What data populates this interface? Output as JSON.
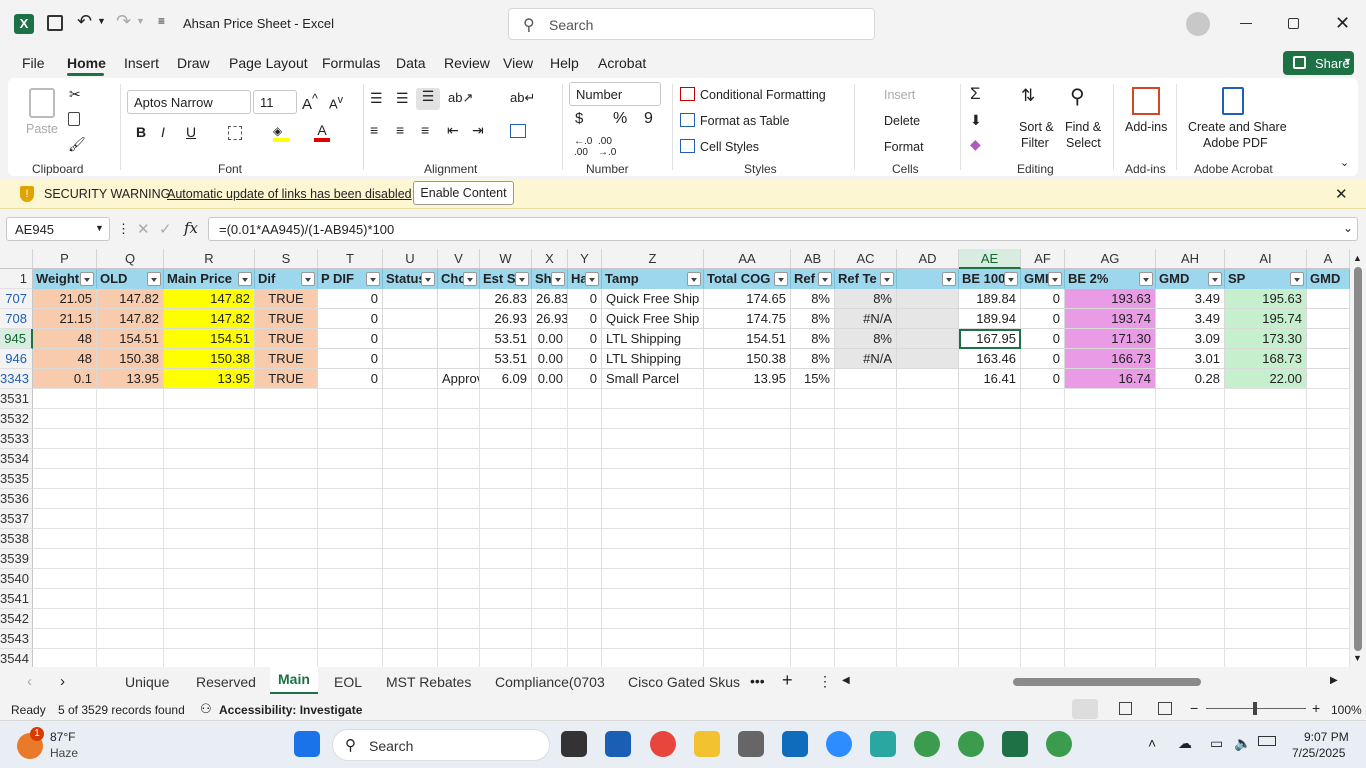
{
  "titlebar": {
    "title": "Ahsan Price Sheet  -  Excel",
    "search_placeholder": "Search"
  },
  "menu": [
    "File",
    "Home",
    "Insert",
    "Draw",
    "Page Layout",
    "Formulas",
    "Data",
    "Review",
    "View",
    "Help",
    "Acrobat"
  ],
  "share_label": "Share",
  "ribbon": {
    "paste": "Paste",
    "clipboard": "Clipboard",
    "font_name": "Aptos Narrow",
    "font_size": "11",
    "font": "Font",
    "alignment": "Alignment",
    "number_format": "Number",
    "number": "Number",
    "cond_format": "Conditional Formatting",
    "format_table": "Format as Table",
    "cell_styles": "Cell Styles",
    "styles": "Styles",
    "insert": "Insert",
    "delete": "Delete",
    "format": "Format",
    "cells": "Cells",
    "sort_filter": [
      "Sort &",
      "Filter"
    ],
    "find_select": [
      "Find &",
      "Select"
    ],
    "editing": "Editing",
    "addins_btn": "Add-ins",
    "addins": "Add-ins",
    "create_pdf": [
      "Create and Share",
      "Adobe PDF"
    ],
    "acrobat": "Adobe Acrobat"
  },
  "security": {
    "title": "SECURITY WARNING",
    "message": "Automatic update of links has been disabled",
    "button": "Enable Content"
  },
  "formula_bar": {
    "name_box": "AE945",
    "formula": "=(0.01*AA945)/(1-AB945)*100"
  },
  "columns": [
    "P",
    "Q",
    "R",
    "S",
    "T",
    "U",
    "V",
    "W",
    "X",
    "Y",
    "Z",
    "AA",
    "AB",
    "AC",
    "AD",
    "AE",
    "AF",
    "AG",
    "AH",
    "AI",
    "A"
  ],
  "headers": [
    "Weight",
    "OLD",
    "Main Price",
    "Dif",
    "P DIF",
    "Status",
    "Cho",
    "Est S",
    "Sh",
    "Ha",
    "Tamp",
    "Total COG",
    "Ref",
    "Ref Te",
    "",
    "BE 100",
    "GMI",
    "BE 2%",
    "GMD",
    "SP",
    "GMD"
  ],
  "header_row_num": "1",
  "rows": [
    {
      "num": "707",
      "cells": [
        "21.05",
        "147.82",
        "147.82",
        "TRUE",
        "0",
        "",
        "",
        "26.83",
        "26.83",
        "0",
        "Quick Free Ship",
        "174.65",
        "8%",
        "8%",
        "",
        "189.84",
        "0",
        "193.63",
        "3.49",
        "195.63",
        ""
      ]
    },
    {
      "num": "708",
      "cells": [
        "21.15",
        "147.82",
        "147.82",
        "TRUE",
        "0",
        "",
        "",
        "26.93",
        "26.93",
        "0",
        "Quick Free Ship",
        "174.75",
        "8%",
        "#N/A",
        "",
        "189.94",
        "0",
        "193.74",
        "3.49",
        "195.74",
        ""
      ]
    },
    {
      "num": "945",
      "cells": [
        "48",
        "154.51",
        "154.51",
        "TRUE",
        "0",
        "",
        "",
        "53.51",
        "0.00",
        "0",
        "LTL Shipping",
        "154.51",
        "8%",
        "8%",
        "",
        "167.95",
        "0",
        "171.30",
        "3.09",
        "173.30",
        ""
      ]
    },
    {
      "num": "946",
      "cells": [
        "48",
        "150.38",
        "150.38",
        "TRUE",
        "0",
        "",
        "",
        "53.51",
        "0.00",
        "0",
        "LTL Shipping",
        "150.38",
        "8%",
        "#N/A",
        "",
        "163.46",
        "0",
        "166.73",
        "3.01",
        "168.73",
        ""
      ]
    },
    {
      "num": "3343",
      "cells": [
        "0.1",
        "13.95",
        "13.95",
        "TRUE",
        "0",
        "",
        "Approv",
        "6.09",
        "0.00",
        "0",
        "Small Parcel",
        "13.95",
        "15%",
        "",
        "",
        "16.41",
        "0",
        "16.74",
        "0.28",
        "22.00",
        ""
      ]
    }
  ],
  "empty_rows": [
    "3531",
    "3532",
    "3533",
    "3534",
    "3535",
    "3536",
    "3537",
    "3538",
    "3539",
    "3540",
    "3541",
    "3542",
    "3543",
    "3544"
  ],
  "sheet_tabs": [
    "Unique",
    "Reserved",
    "Main",
    "EOL",
    "MST Rebates",
    "Compliance(0703",
    "Cisco Gated Skus"
  ],
  "active_tab": "Main",
  "status": {
    "ready": "Ready",
    "records": "5 of 3529 records found",
    "accessibility": "Accessibility: Investigate",
    "zoom": "100%"
  },
  "taskbar": {
    "weather_temp": "87°F",
    "weather_desc": "Haze",
    "search": "Search",
    "time": "9:07 PM",
    "date": "7/25/2025",
    "badge": "1"
  },
  "colors": {
    "excel_green": "#1e7145",
    "header_blue": "#9dd7ee",
    "peach": "#f8cbad",
    "yellow": "#ffff00",
    "pink": "#e99be6",
    "green_fill": "#c6efce",
    "gray_fill": "#e7e6e6"
  }
}
